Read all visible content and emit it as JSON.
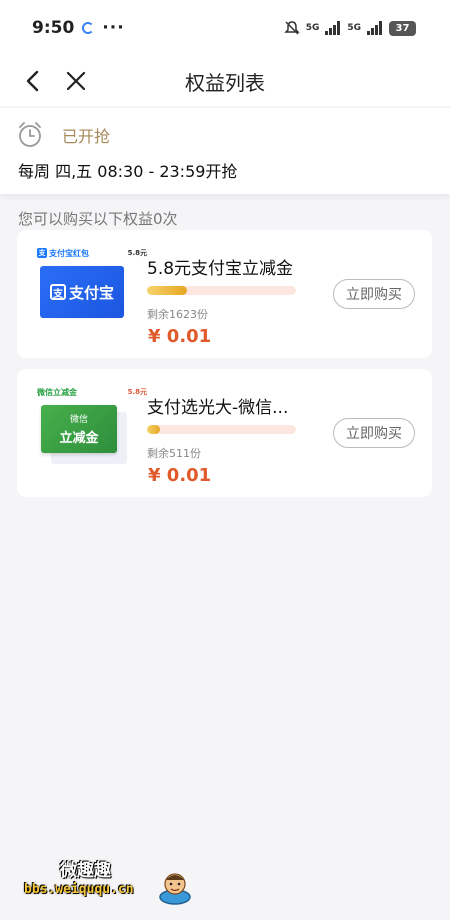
{
  "status_bar": {
    "time": "9:50",
    "dots": "···",
    "signal_1": "5G",
    "signal_2": "5G",
    "battery": "37",
    "icons": [
      "sync-icon",
      "mute-icon",
      "signal-icon",
      "battery-icon"
    ]
  },
  "nav": {
    "title": "权益列表",
    "back_icon": "chevron-left-icon",
    "close_icon": "close-icon"
  },
  "time_info": {
    "status": "已开抢",
    "schedule": "每周 四,五 08:30 - 23:59开抢",
    "icon": "alarm-clock-icon"
  },
  "summary": "您可以购买以下权益0次",
  "items": [
    {
      "thumb_brand": "支付宝红包",
      "thumb_value": "5.8元",
      "thumb_block_text": "支付宝",
      "title": "5.8元支付宝立减金",
      "progress": 0.27,
      "remain": "剩余1623份",
      "price": "¥ 0.01",
      "button": "立即购买"
    },
    {
      "thumb_brand": "微信立减金",
      "thumb_value": "5.8元",
      "thumb_block_small": "微信",
      "thumb_block_big": "立减金",
      "title": "支付选光大-微信...",
      "progress": 0.09,
      "remain": "剩余511份",
      "price": "¥ 0.01",
      "button": "立即购买"
    }
  ],
  "watermark": {
    "main": "微趣趣",
    "url": "bbs.weiququ.cn"
  },
  "colors": {
    "accent_gold": "#a7895a",
    "price_red": "#e05a2b",
    "progress_fill": "#e6a622",
    "progress_track": "#fde6df"
  }
}
